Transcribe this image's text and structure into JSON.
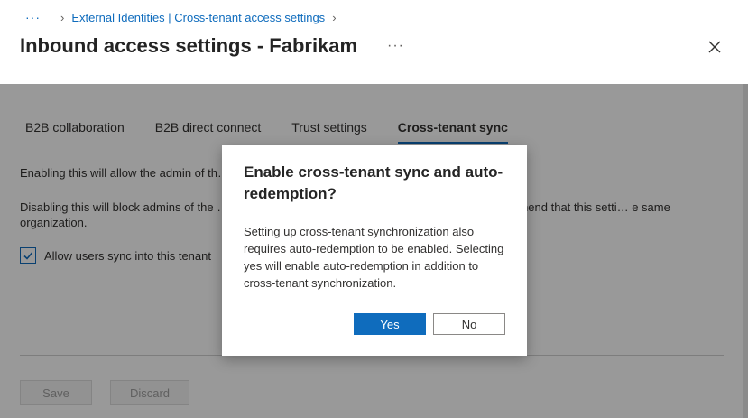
{
  "header": {
    "breadcrumb_dots": "···",
    "breadcrumb_item": "External Identities | Cross-tenant access settings",
    "title": "Inbound access settings - Fabrikam",
    "more_label": "···"
  },
  "tabs": [
    {
      "label": "B2B collaboration"
    },
    {
      "label": "B2B direct connect"
    },
    {
      "label": "Trust settings"
    },
    {
      "label": "Cross-tenant sync"
    }
  ],
  "content": {
    "para1": "Enabling this will allow the admin of th… tenant.",
    "para2": "Disabling this will block admins of the … but will not remove currently synced objects. We recommend that this setti… e same organization.",
    "checkbox_label": "Allow users sync into this tenant",
    "checkbox_checked": true
  },
  "footer": {
    "save_label": "Save",
    "discard_label": "Discard"
  },
  "dialog": {
    "title": "Enable cross-tenant sync and auto-redemption?",
    "text": "Setting up cross-tenant synchronization also requires auto-redemption to be enabled. Selecting yes will enable auto-redemption in addition to cross-tenant synchronization.",
    "yes_label": "Yes",
    "no_label": "No"
  },
  "colors": {
    "accent": "#0f6cbd",
    "overlay": "rgba(0,0,0,0.40)"
  }
}
